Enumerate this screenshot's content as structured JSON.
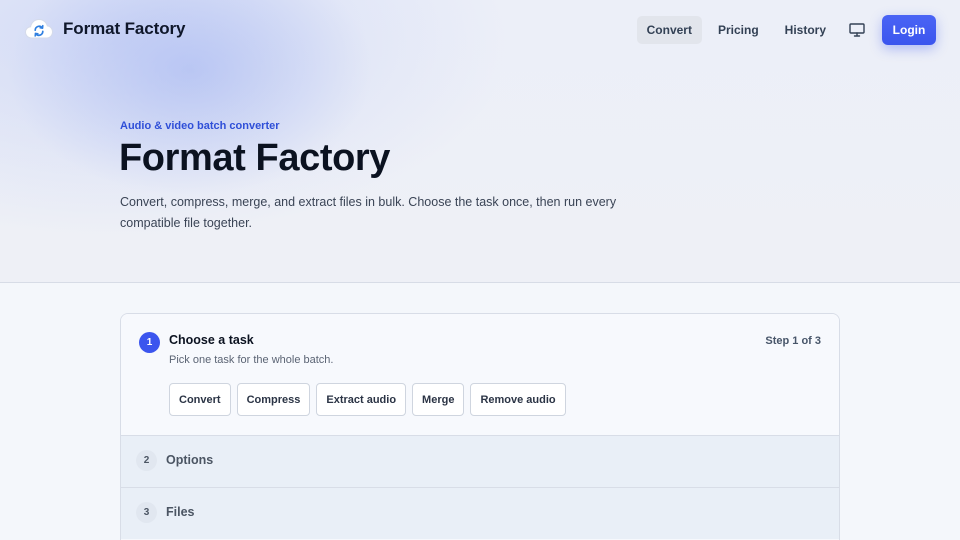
{
  "header": {
    "brand_name": "Format Factory",
    "nav": [
      {
        "label": "Convert",
        "active": true
      },
      {
        "label": "Pricing",
        "active": false
      },
      {
        "label": "History",
        "active": false
      }
    ],
    "monitor_icon": "monitor-icon",
    "login_label": "Login"
  },
  "hero": {
    "eyebrow": "Audio & video batch converter",
    "title": "Format Factory",
    "description": "Convert, compress, merge, and extract files in bulk. Choose the task once, then run every compatible file together."
  },
  "steps": {
    "active": {
      "number": "1",
      "title": "Choose a task",
      "subtitle": "Pick one task for the whole batch.",
      "counter": "Step 1 of 3",
      "tasks": [
        "Convert",
        "Compress",
        "Extract audio",
        "Merge",
        "Remove audio"
      ]
    },
    "collapsed": [
      {
        "number": "2",
        "title": "Options"
      },
      {
        "number": "3",
        "title": "Files"
      }
    ]
  },
  "colors": {
    "accent": "#3b55ee",
    "eyebrow": "#2f4fd8"
  }
}
